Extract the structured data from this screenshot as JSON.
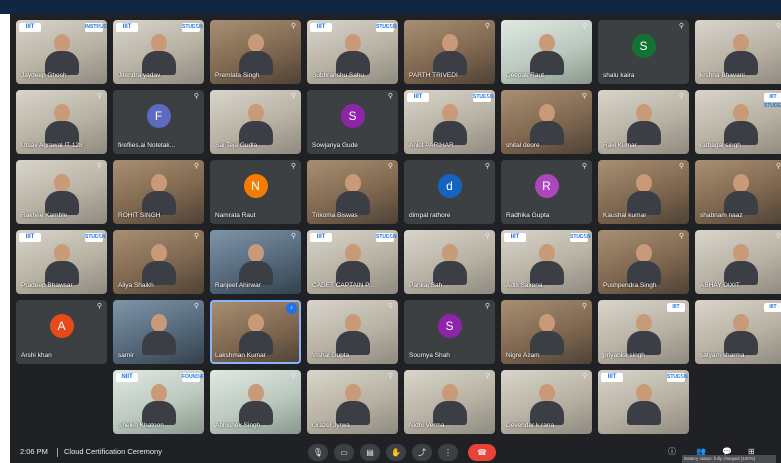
{
  "meeting": {
    "time": "2:06 PM",
    "title": "Cloud Certification Ceremony",
    "tooltip": "Battery status: fully charged (100%)"
  },
  "colors": {
    "background": "#202124",
    "tile": "#3c4043",
    "end_call": "#ea4335",
    "accent": "#1a73e8"
  },
  "controls": [
    {
      "name": "mic-button",
      "icon": "mic-icon",
      "glyph": "🎙"
    },
    {
      "name": "camera-button",
      "icon": "camera-icon",
      "glyph": "▭"
    },
    {
      "name": "captions-button",
      "icon": "captions-icon",
      "glyph": "▤"
    },
    {
      "name": "raise-hand-button",
      "icon": "hand-icon",
      "glyph": "✋"
    },
    {
      "name": "present-button",
      "icon": "present-icon",
      "glyph": "⤴"
    },
    {
      "name": "more-options-button",
      "icon": "more-vert-icon",
      "glyph": "⋮"
    },
    {
      "name": "leave-call-button",
      "icon": "phone-end-icon",
      "glyph": "☎"
    }
  ],
  "right_icons": [
    {
      "name": "info-button",
      "icon": "info-icon",
      "glyph": "ⓘ"
    },
    {
      "name": "people-button",
      "icon": "people-icon",
      "glyph": "👥"
    },
    {
      "name": "chat-button",
      "icon": "chat-icon",
      "glyph": "💬"
    },
    {
      "name": "activities-button",
      "icon": "shapes-icon",
      "glyph": "⊞"
    }
  ],
  "participants": [
    {
      "name": "Jaydeep Ghosh",
      "type": "video",
      "tone": "light",
      "logo": "IIIT",
      "tag": "INSTRUCTO"
    },
    {
      "name": "Jitendra yadav",
      "type": "video",
      "tone": "light",
      "logo": "IIIT",
      "tag": "STUDEN"
    },
    {
      "name": "Premlata Singh",
      "type": "photo",
      "tone": "warm"
    },
    {
      "name": "Subhranshu Sahu",
      "type": "video",
      "tone": "light",
      "logo": "IIIT",
      "tag": "STUDEN"
    },
    {
      "name": "PARTH TRIVEDI",
      "type": "video",
      "tone": "warm"
    },
    {
      "name": "Deepak Raut",
      "type": "video",
      "tone": "green"
    },
    {
      "name": "shalu kaira",
      "type": "avatar",
      "initial": "S",
      "color": "#137333"
    },
    {
      "name": "krshna Bhavani",
      "type": "video",
      "tone": "light"
    },
    {
      "name": "Utsav Agrawal IT 128",
      "type": "video",
      "tone": "light"
    },
    {
      "name": "fireflies.ai Notetak...",
      "type": "avatar",
      "initial": "F",
      "color": "#5c6bc0"
    },
    {
      "name": "Sai Teja Gudla",
      "type": "video",
      "tone": "light"
    },
    {
      "name": "Sowjanya Gude",
      "type": "avatar",
      "initial": "S",
      "color": "#8e24aa"
    },
    {
      "name": "Ankit PARIHAR",
      "type": "video",
      "tone": "light",
      "logo": "IIIT",
      "tag": "STUDEN"
    },
    {
      "name": "shital deore",
      "type": "video",
      "tone": "warm"
    },
    {
      "name": "Ravi Kumar",
      "type": "video",
      "tone": "light"
    },
    {
      "name": "rathagal singh",
      "type": "video",
      "tone": "light",
      "logo": "",
      "tag": "IIIT STUDEN"
    },
    {
      "name": "Rakhee Kamble",
      "type": "video",
      "tone": "light"
    },
    {
      "name": "ROHIT SINGH",
      "type": "video",
      "tone": "warm"
    },
    {
      "name": "Namrata Raut",
      "type": "avatar",
      "initial": "N",
      "color": "#f57c00"
    },
    {
      "name": "Trikoma Biswas",
      "type": "photo",
      "tone": "warm"
    },
    {
      "name": "dimpal rathore",
      "type": "avatar",
      "initial": "d",
      "color": "#1565c0"
    },
    {
      "name": "Radhika Gupta",
      "type": "avatar",
      "initial": "R",
      "color": "#ab47bc"
    },
    {
      "name": "Kaushal kumar",
      "type": "video",
      "tone": "warm"
    },
    {
      "name": "shabnam naaz",
      "type": "video",
      "tone": "warm"
    },
    {
      "name": "Pradeep Bhawsar",
      "type": "video",
      "tone": "light",
      "logo": "IIIT",
      "tag": "STUDEN"
    },
    {
      "name": "Aliya Shaikh",
      "type": "video",
      "tone": "warm"
    },
    {
      "name": "Ranjeet Ahirwar",
      "type": "photo",
      "tone": "blue"
    },
    {
      "name": "CADET CAPTAIN P...",
      "type": "video",
      "tone": "light",
      "logo": "IIIT",
      "tag": "STUDEN"
    },
    {
      "name": "Pankaj Sah",
      "type": "video",
      "tone": "light"
    },
    {
      "name": "Aditi Saxena",
      "type": "video",
      "tone": "light",
      "logo": "IIIT",
      "tag": "STUDEN"
    },
    {
      "name": "Pushpendra Singh",
      "type": "photo",
      "tone": "warm"
    },
    {
      "name": "ABHAY DIXIT",
      "type": "photo",
      "tone": "light"
    },
    {
      "name": "Arshi khan",
      "type": "avatar",
      "initial": "A",
      "color": "#e64a19"
    },
    {
      "name": "samir",
      "type": "photo",
      "tone": "blue"
    },
    {
      "name": "Lakshman Kumar",
      "type": "video",
      "tone": "warm",
      "active": true
    },
    {
      "name": "Vishal Gupta",
      "type": "video",
      "tone": "light"
    },
    {
      "name": "Soumya Shah",
      "type": "avatar",
      "initial": "S",
      "color": "#8e24aa"
    },
    {
      "name": "Nigre Azam",
      "type": "video",
      "tone": "warm"
    },
    {
      "name": "priyanka singh",
      "type": "video",
      "tone": "light",
      "logo": "",
      "tag": "IIIT"
    },
    {
      "name": "satyam sharma",
      "type": "video",
      "tone": "light",
      "logo": "",
      "tag": "IIIT"
    },
    {
      "name": "Sheikh Khatoon",
      "type": "video",
      "tone": "green",
      "logo": "NIIT",
      "tag": "FOUNDATION"
    },
    {
      "name": "Abhishek Singh",
      "type": "photo",
      "tone": "green"
    },
    {
      "name": "Grazel Jyrwa",
      "type": "photo",
      "tone": "light"
    },
    {
      "name": "Nidhi Verma",
      "type": "video",
      "tone": "light"
    },
    {
      "name": "Devendar k rana",
      "type": "photo",
      "tone": "light"
    },
    {
      "name": "",
      "type": "video",
      "tone": "light",
      "logo": "IIIT",
      "tag": "STUDEN"
    }
  ]
}
